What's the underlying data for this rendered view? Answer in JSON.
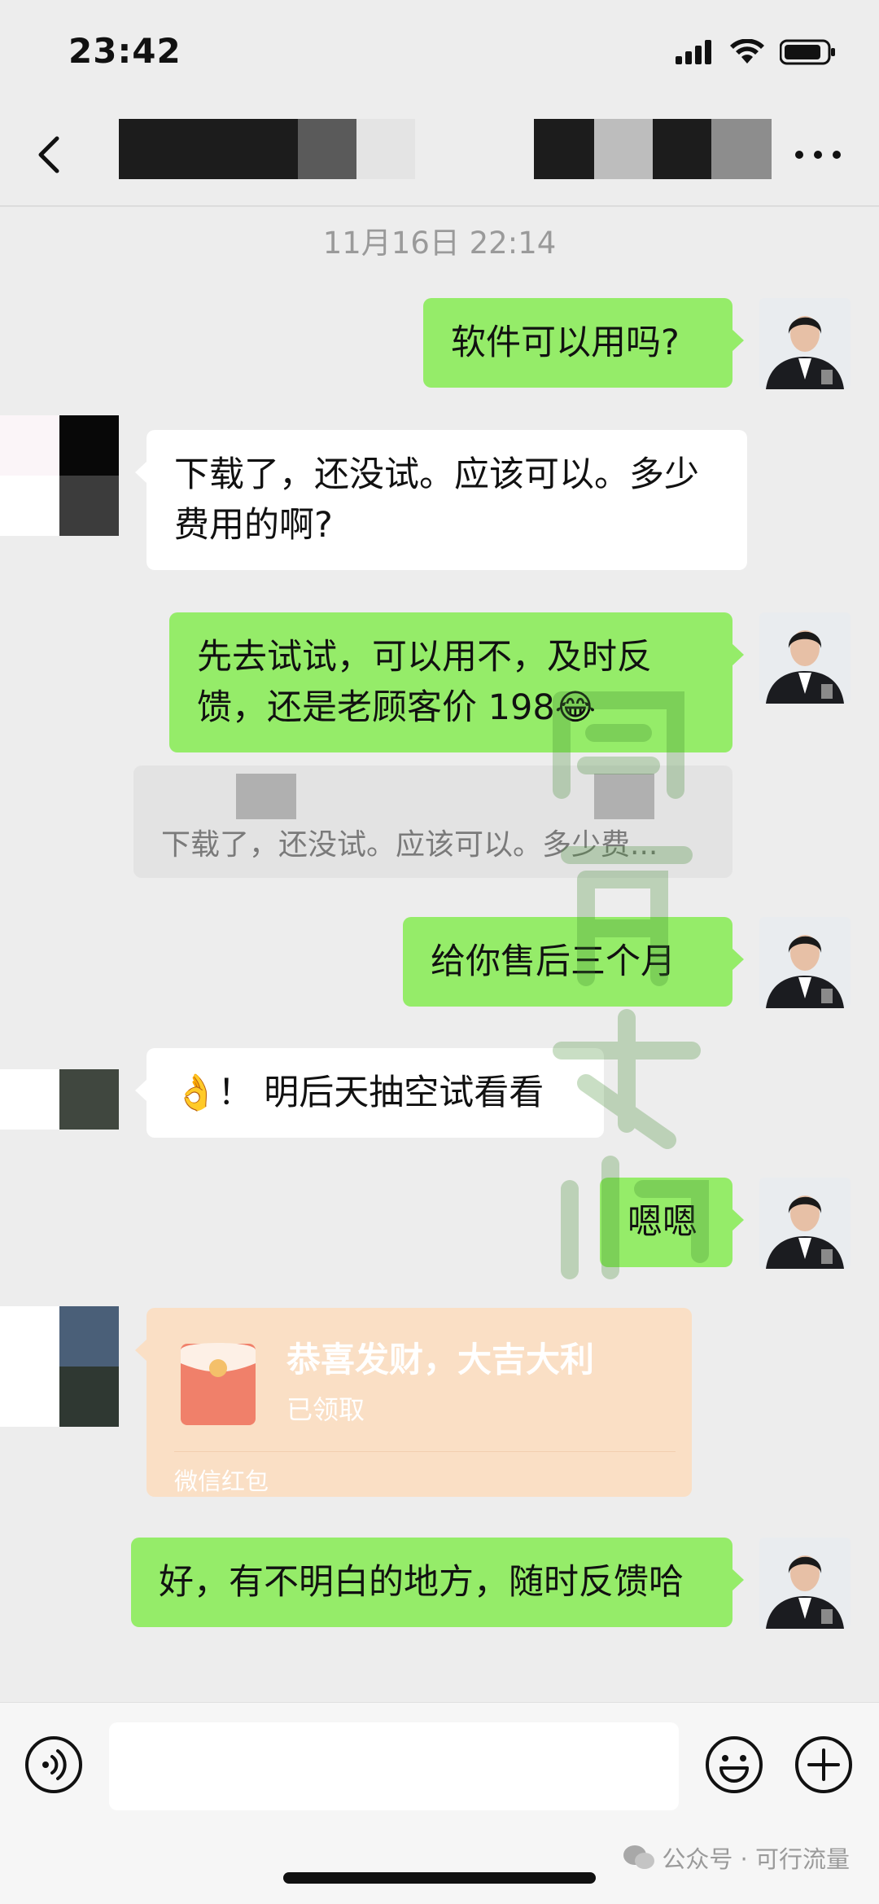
{
  "status_bar": {
    "time": "23:42"
  },
  "chat": {
    "timestamp": "11月16日 22:14",
    "messages": [
      {
        "from": "me",
        "text": "软件可以用吗?"
      },
      {
        "from": "them",
        "text": "下载了，还没试。应该可以。多少费用的啊?"
      },
      {
        "from": "me",
        "text": "先去试试，可以用不，及时反馈，还是老顾客价 198😂"
      },
      {
        "from": "me_quote",
        "text": "下载了，还没试。应该可以。多少费..."
      },
      {
        "from": "me",
        "text": "给你售后三个月"
      },
      {
        "from": "them",
        "text": "👌！ 明后天抽空试看看"
      },
      {
        "from": "me",
        "text": "嗯嗯"
      },
      {
        "from": "them_redpacket",
        "title": "恭喜发财，大吉大利",
        "status": "已领取",
        "footer": "微信红包"
      },
      {
        "from": "me",
        "text": "好，有不明白的地方，随时反馈哈"
      }
    ]
  },
  "source_mark": "公众号 · 可行流量",
  "colors": {
    "my_bubble": "#95ec69",
    "their_bubble": "#ffffff",
    "background": "#ededed",
    "red_packet": "#fadfc5"
  }
}
